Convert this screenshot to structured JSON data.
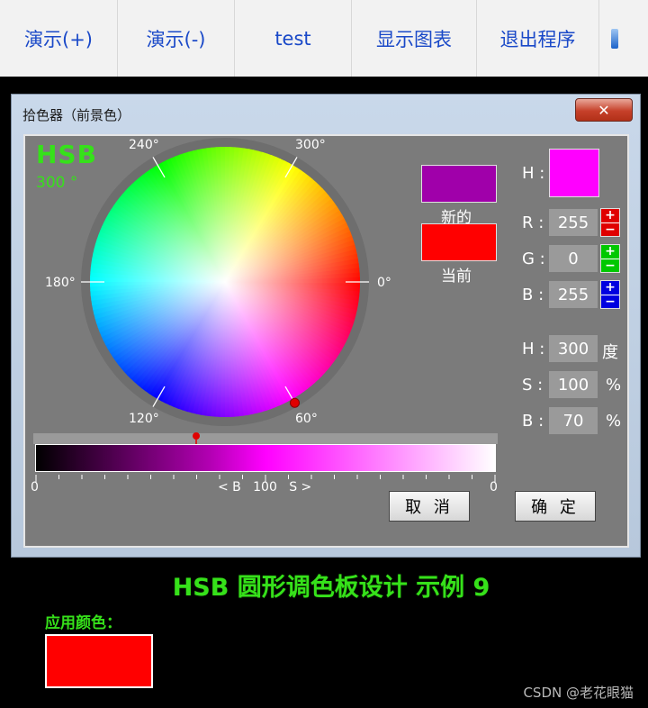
{
  "toolbar": {
    "buttons": [
      "演示(+)",
      "演示(-)",
      "test",
      "显示图表",
      "退出程序"
    ],
    "more_icon": "scroll-indicator-icon"
  },
  "dialog": {
    "title": "拾色器（前景色）",
    "close_label": "✕",
    "mode": "HSB",
    "hue_readout": "300 °",
    "wheel_angles": [
      "0°",
      "60°",
      "120°",
      "180°",
      "240°",
      "300°"
    ],
    "new_label": "新的",
    "current_label": "当前",
    "new_color": "#a000aa",
    "current_color": "#ff0000",
    "preview_color": "#ff00ff",
    "rgb": {
      "r_label": "R :",
      "r_value": "255",
      "g_label": "G :",
      "g_value": "0",
      "b_label": "B :",
      "b_value": "255"
    },
    "hsb": {
      "h_label": "H :",
      "h_value": "300",
      "h_unit": "度",
      "s_label": "S :",
      "s_value": "100",
      "s_unit": "%",
      "b_label": "B :",
      "b_value": "70",
      "b_unit": "%"
    },
    "preview_label": "H :",
    "slider": {
      "left_label": "0",
      "right_label": "0",
      "center_label": "< B   100   S >",
      "marker_fraction": 0.35
    },
    "cancel_label": "取 消",
    "ok_label": "确 定"
  },
  "caption": "HSB 圆形调色板设计 示例 9",
  "apply": {
    "label": "应用颜色：",
    "color": "#ff0000"
  },
  "watermark": "CSDN @老花眼猫"
}
